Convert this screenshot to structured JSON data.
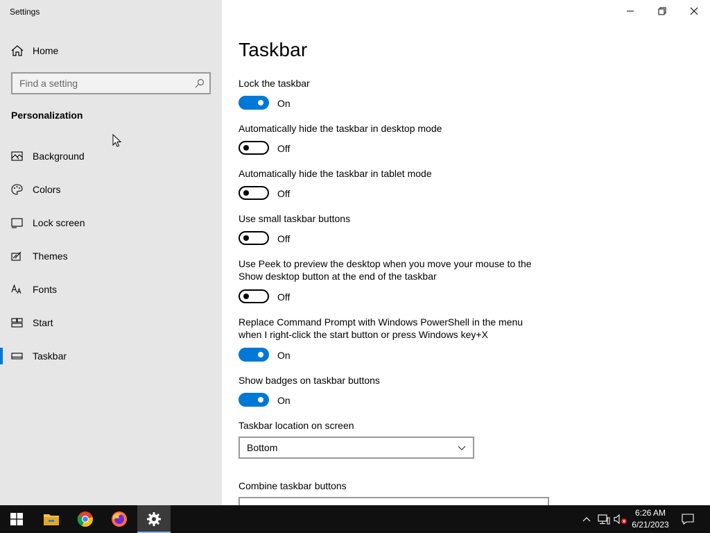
{
  "window": {
    "title": "Settings"
  },
  "sidebar": {
    "home_label": "Home",
    "search_placeholder": "Find a setting",
    "section_title": "Personalization",
    "items": [
      {
        "label": "Background",
        "icon": "picture-icon"
      },
      {
        "label": "Colors",
        "icon": "palette-icon"
      },
      {
        "label": "Lock screen",
        "icon": "lock-screen-icon"
      },
      {
        "label": "Themes",
        "icon": "themes-icon"
      },
      {
        "label": "Fonts",
        "icon": "fonts-icon"
      },
      {
        "label": "Start",
        "icon": "start-icon"
      },
      {
        "label": "Taskbar",
        "icon": "taskbar-icon",
        "active": true
      }
    ]
  },
  "main": {
    "title": "Taskbar",
    "settings": [
      {
        "label": "Lock the taskbar",
        "state": "On"
      },
      {
        "label": "Automatically hide the taskbar in desktop mode",
        "state": "Off"
      },
      {
        "label": "Automatically hide the taskbar in tablet mode",
        "state": "Off"
      },
      {
        "label": "Use small taskbar buttons",
        "state": "Off"
      },
      {
        "label": "Use Peek to preview the desktop when you move your mouse to the Show desktop button at the end of the taskbar",
        "state": "Off"
      },
      {
        "label": "Replace Command Prompt with Windows PowerShell in the menu when I right-click the start button or press Windows key+X",
        "state": "On"
      },
      {
        "label": "Show badges on taskbar buttons",
        "state": "On"
      }
    ],
    "location_label": "Taskbar location on screen",
    "location_value": "Bottom",
    "combine_label": "Combine taskbar buttons"
  },
  "taskbar": {
    "time": "6:26 AM",
    "date": "6/21/2023",
    "apps": [
      "start-icon",
      "file-explorer-icon",
      "chrome-icon",
      "firefox-icon",
      "settings-gear-icon"
    ]
  },
  "colors": {
    "accent": "#0078d7",
    "sidebar_bg": "#e6e6e6",
    "taskbar_bg": "#101010"
  }
}
